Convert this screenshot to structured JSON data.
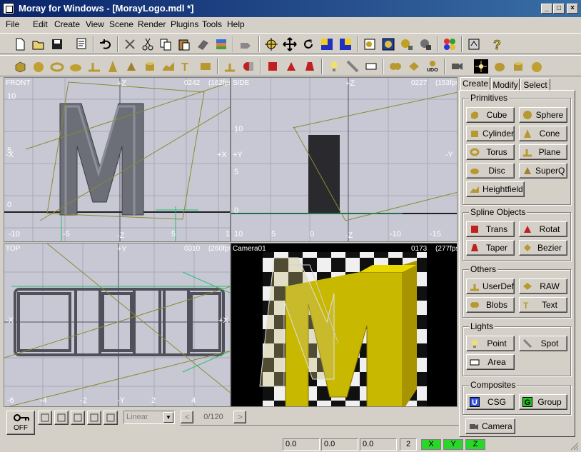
{
  "window": {
    "title": "Moray for Windows - [MorayLogo.mdl *]",
    "buttons": [
      "_",
      "□",
      "×"
    ]
  },
  "menu": {
    "items": [
      "File",
      "Edit",
      "Create",
      "View",
      "Scene",
      "Render",
      "Plugins",
      "Tools",
      "Help"
    ]
  },
  "viewports": {
    "front": {
      "name": "FRONT",
      "count": "0242",
      "fps": "(162fps)",
      "top_axis": "+Z",
      "bottom_axis": "-Z",
      "left_axis": "-X",
      "right_axis": "+X",
      "ticks_y": [
        "10",
        "5",
        "0"
      ],
      "ticks_x": [
        "-10",
        "-5",
        "0",
        "5",
        "1"
      ]
    },
    "side": {
      "name": "SIDE",
      "count": "0227",
      "fps": "(153fps)",
      "top_axis": "+Z",
      "bottom_axis": "-Z",
      "left_axis": "+Y",
      "right_axis": "-Y",
      "ticks_y": [
        "10",
        "5",
        "0"
      ],
      "ticks_x": [
        "10",
        "5",
        "0",
        "-5",
        "-10",
        "-15"
      ]
    },
    "top": {
      "name": "TOP",
      "count": "0310",
      "fps": "(260fps)",
      "top_axis": "+Y",
      "bottom_axis": "-Y",
      "left_axis": "-X",
      "right_axis": "+X",
      "ticks_x": [
        "-6",
        "-4",
        "-2",
        "0",
        "2",
        "4"
      ]
    },
    "camera": {
      "name": "Camera01",
      "count": "0173",
      "fps": "(277fps)"
    }
  },
  "panel": {
    "tabs": [
      "Create",
      "Modify",
      "Select"
    ],
    "groups": [
      {
        "title": "Primitives",
        "buttons": [
          "Cube",
          "Sphere",
          "Cylinder",
          "Cone",
          "Torus",
          "Plane",
          "Disc",
          "SuperQ",
          "Heightfield"
        ]
      },
      {
        "title": "Spline Objects",
        "buttons": [
          "Trans",
          "Rotat",
          "Taper",
          "Bezier"
        ]
      },
      {
        "title": "Others",
        "buttons": [
          "UserDef",
          "RAW",
          "Blobs",
          "Text"
        ]
      },
      {
        "title": "Lights",
        "buttons": [
          "Point",
          "Spot",
          "Area"
        ]
      },
      {
        "title": "Composites",
        "buttons": [
          "CSG",
          "Group"
        ]
      }
    ],
    "camera_button": "Camera"
  },
  "animation": {
    "key_label": "OFF",
    "interp": "Linear",
    "frame": "0/120",
    "prev": "<",
    "next": ">"
  },
  "status": {
    "x": "0.0",
    "y": "0.0",
    "z": "0.0",
    "grid": "2",
    "axis_x": "X",
    "axis_y": "Y",
    "axis_z": "Z"
  }
}
